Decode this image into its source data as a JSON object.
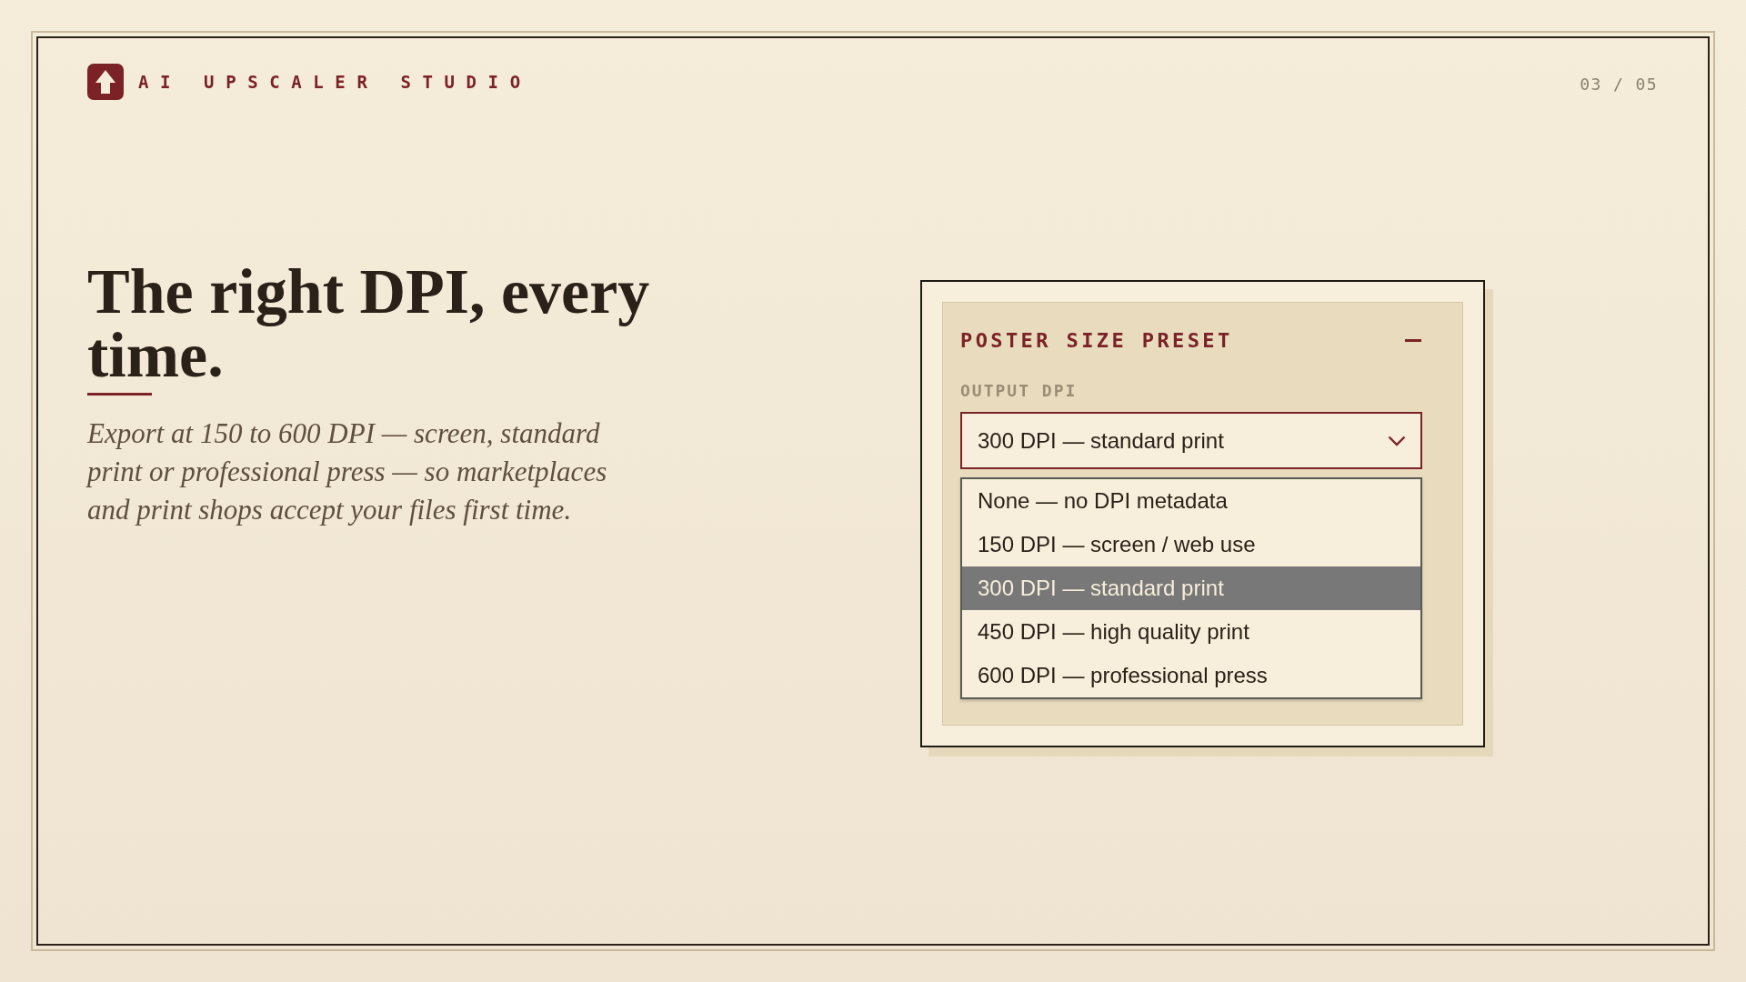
{
  "brand": {
    "name": "AI UPSCALER STUDIO"
  },
  "page_indicator": "03 / 05",
  "hero": {
    "title": "The right DPI, every time.",
    "description": "Export at 150 to 600 DPI — screen, standard print or professional press — so marketplaces and print shops accept your files first time."
  },
  "panel": {
    "title": "POSTER SIZE PRESET",
    "expanded": true,
    "field": {
      "label": "OUTPUT DPI",
      "value": "300 DPI — standard print",
      "open": true,
      "options": [
        {
          "label": "None — no DPI metadata",
          "selected": false
        },
        {
          "label": "150 DPI — screen / web use",
          "selected": false
        },
        {
          "label": "300 DPI — standard print",
          "selected": true
        },
        {
          "label": "450 DPI — high quality print",
          "selected": false
        },
        {
          "label": "600 DPI — professional press",
          "selected": false
        }
      ]
    }
  }
}
